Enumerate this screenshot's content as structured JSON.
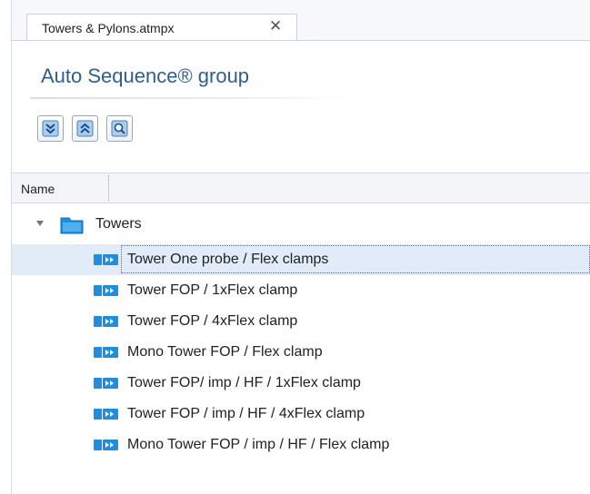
{
  "tab": {
    "label": "Towers & Pylons.atmpx",
    "close_symbol": "✕"
  },
  "panel": {
    "title": "Auto Sequence® group"
  },
  "toolbar": {
    "buttons": [
      {
        "icon": "expand-all-icon"
      },
      {
        "icon": "collapse-all-icon"
      },
      {
        "icon": "search-icon"
      }
    ]
  },
  "columns": {
    "name_header": "Name"
  },
  "tree": {
    "folder": {
      "label": "Towers",
      "icon": "folder-icon",
      "expanded": true
    },
    "items": [
      {
        "label": "Tower One probe / Flex clamps",
        "selected": true
      },
      {
        "label": "Tower FOP / 1xFlex clamp"
      },
      {
        "label": "Tower FOP / 4xFlex clamp"
      },
      {
        "label": "Mono Tower FOP / Flex clamp"
      },
      {
        "label": "Tower FOP/ imp / HF / 1xFlex clamp"
      },
      {
        "label": "Tower FOP / imp / HF / 4xFlex clamp"
      },
      {
        "label": "Mono Tower FOP / imp / HF / Flex clamp"
      }
    ]
  },
  "colors": {
    "accent": "#2e5e8f",
    "selection": "#e1ecf8",
    "icon_blue": "#1e8fe0"
  }
}
